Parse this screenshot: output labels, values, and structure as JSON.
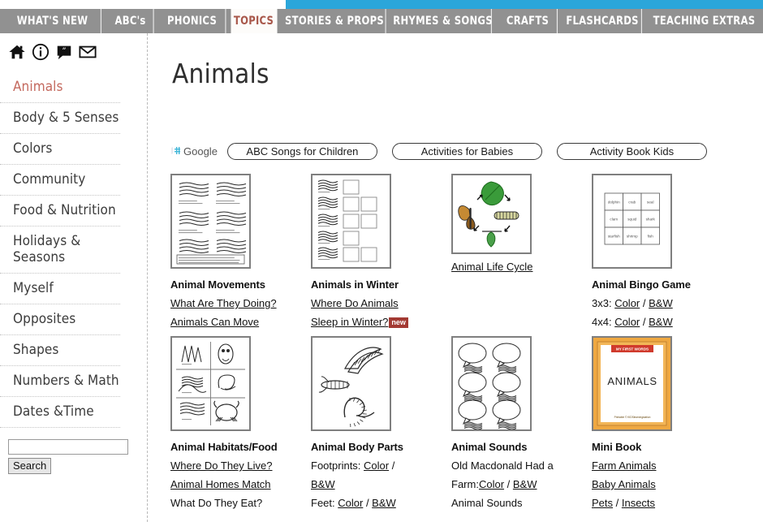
{
  "nav": {
    "tabs": [
      {
        "label": "WHAT'S NEW",
        "active": false
      },
      {
        "label": "ABC's",
        "active": false
      },
      {
        "label": "PHONICS",
        "active": false
      },
      {
        "label": "TOPICS",
        "active": true
      },
      {
        "label": "STORIES & PROPS",
        "active": false
      },
      {
        "label": "RHYMES & SONGS",
        "active": false
      },
      {
        "label": "CRAFTS",
        "active": false
      },
      {
        "label": "FLASHCARDS",
        "active": false
      },
      {
        "label": "TEACHING EXTRAS",
        "active": false
      }
    ],
    "active_color": "#a8574a",
    "bar_color": "#919191",
    "strip_color": "#2ba6da"
  },
  "sidebar": {
    "icons": [
      "home-icon",
      "info-icon",
      "comment-icon",
      "mail-icon"
    ],
    "items": [
      {
        "label": "Animals",
        "active": true
      },
      {
        "label": "Body & 5 Senses",
        "active": false
      },
      {
        "label": "Colors",
        "active": false
      },
      {
        "label": "Community",
        "active": false
      },
      {
        "label": "Food & Nutrition",
        "active": false
      },
      {
        "label": "Holidays & Seasons",
        "active": false
      },
      {
        "label": "Myself",
        "active": false
      },
      {
        "label": "Opposites",
        "active": false
      },
      {
        "label": "Shapes",
        "active": false
      },
      {
        "label": "Numbers & Math",
        "active": false
      },
      {
        "label": "Dates &Time",
        "active": false
      }
    ],
    "search": {
      "value": "",
      "placeholder": "",
      "button_label": "Search"
    }
  },
  "main": {
    "title": "Animals"
  },
  "ads": {
    "provider_label": "Google",
    "chips": [
      {
        "label": "ABC Songs for Children"
      },
      {
        "label": "Activities for Babies"
      },
      {
        "label": "Activity Book Kids"
      }
    ]
  },
  "cards": [
    {
      "thumb": "animal-movements-worksheet",
      "title": "Animal Movements",
      "lines": [
        {
          "parts": [
            {
              "text": "What Are They Doing?",
              "link": true
            }
          ]
        },
        {
          "parts": [
            {
              "text": "Animals Can Move",
              "link": true
            }
          ]
        }
      ]
    },
    {
      "thumb": "animals-in-winter-worksheet",
      "title": "Animals in Winter",
      "lines": [
        {
          "parts": [
            {
              "text": "Where Do Animals",
              "link": true
            }
          ]
        },
        {
          "parts": [
            {
              "text": "Sleep in Winter?",
              "link": true
            },
            {
              "text": "new",
              "badge": true
            }
          ]
        }
      ]
    },
    {
      "thumb": "butterfly-life-cycle",
      "title": "",
      "lines": [
        {
          "parts": [
            {
              "text": "Animal Life Cycle",
              "link": true
            }
          ]
        }
      ]
    },
    {
      "thumb": "animal-bingo-grid",
      "title": "Animal Bingo Game",
      "lines": [
        {
          "parts": [
            {
              "text": "3x3: ",
              "link": false
            },
            {
              "text": "Color",
              "link": true
            },
            {
              "text": " / ",
              "link": false
            },
            {
              "text": "B&W",
              "link": true
            }
          ]
        },
        {
          "parts": [
            {
              "text": "4x4: ",
              "link": false
            },
            {
              "text": "Color",
              "link": true
            },
            {
              "text": " / ",
              "link": false
            },
            {
              "text": "B&W",
              "link": true
            }
          ]
        }
      ]
    },
    {
      "thumb": "animal-habitats-worksheet",
      "title": "Animal Habitats/Food",
      "lines": [
        {
          "parts": [
            {
              "text": "Where Do They Live?",
              "link": true
            }
          ]
        },
        {
          "parts": [
            {
              "text": "Animal Homes Match",
              "link": true
            }
          ]
        },
        {
          "parts": [
            {
              "text": "What Do They Eat?",
              "link": false
            }
          ]
        }
      ]
    },
    {
      "thumb": "animal-body-parts-worksheet",
      "title": "Animal Body Parts",
      "lines": [
        {
          "parts": [
            {
              "text": "Footprints: ",
              "link": false
            },
            {
              "text": "Color",
              "link": true
            },
            {
              "text": " /",
              "link": false
            }
          ]
        },
        {
          "parts": [
            {
              "text": "B&W",
              "link": true
            }
          ]
        },
        {
          "parts": [
            {
              "text": "Feet: ",
              "link": false
            },
            {
              "text": "Color",
              "link": true
            },
            {
              "text": " / ",
              "link": false
            },
            {
              "text": "B&W",
              "link": true
            }
          ]
        }
      ]
    },
    {
      "thumb": "animal-sounds-worksheet",
      "title": "Animal Sounds",
      "lines": [
        {
          "parts": [
            {
              "text": "Old Macdonald Had a",
              "link": false
            }
          ]
        },
        {
          "parts": [
            {
              "text": "Farm:",
              "link": false
            },
            {
              "text": "Color",
              "link": true
            },
            {
              "text": " / ",
              "link": false
            },
            {
              "text": "B&W",
              "link": true
            }
          ]
        },
        {
          "parts": [
            {
              "text": "Animal Sounds",
              "link": false
            }
          ]
        }
      ]
    },
    {
      "thumb": "mini-book-cover",
      "title": "Mini Book",
      "lines": [
        {
          "parts": [
            {
              "text": "Farm Animals",
              "link": true
            }
          ]
        },
        {
          "parts": [
            {
              "text": "Baby Animals",
              "link": true
            }
          ]
        },
        {
          "parts": [
            {
              "text": "Pets",
              "link": true
            },
            {
              "text": " / ",
              "link": false
            },
            {
              "text": "Insects",
              "link": true
            }
          ]
        }
      ]
    }
  ],
  "minibook": {
    "banner": "MY FIRST WORDS",
    "title": "ANIMALS"
  },
  "bingo": {
    "cells": [
      "dolphin",
      "crab",
      "seal",
      "clam",
      "squid",
      "shark",
      "starfish",
      "shrimp",
      "fish"
    ]
  }
}
